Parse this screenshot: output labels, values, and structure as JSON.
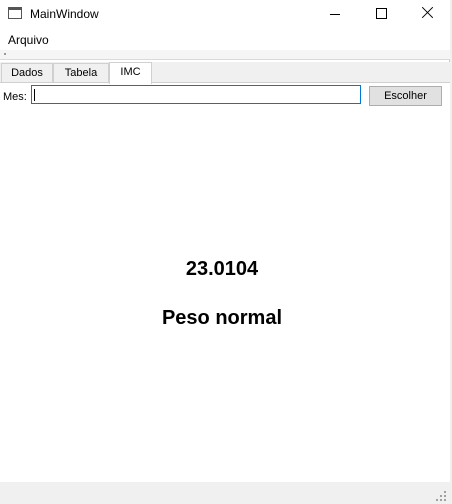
{
  "window": {
    "title": "MainWindow"
  },
  "menu": {
    "items": [
      {
        "label": "Arquivo"
      }
    ]
  },
  "tabs": [
    {
      "label": "Dados",
      "active": false
    },
    {
      "label": "Tabela",
      "active": false
    },
    {
      "label": "IMC",
      "active": true
    }
  ],
  "imc_tab": {
    "mes_label": "Mes:",
    "mes_value": "",
    "choose_button": "Escolher",
    "imc_value": "23.0104",
    "classification": "Peso normal"
  },
  "colors": {
    "focus_border": "#0078d7",
    "button_bg": "#e1e1e1"
  }
}
